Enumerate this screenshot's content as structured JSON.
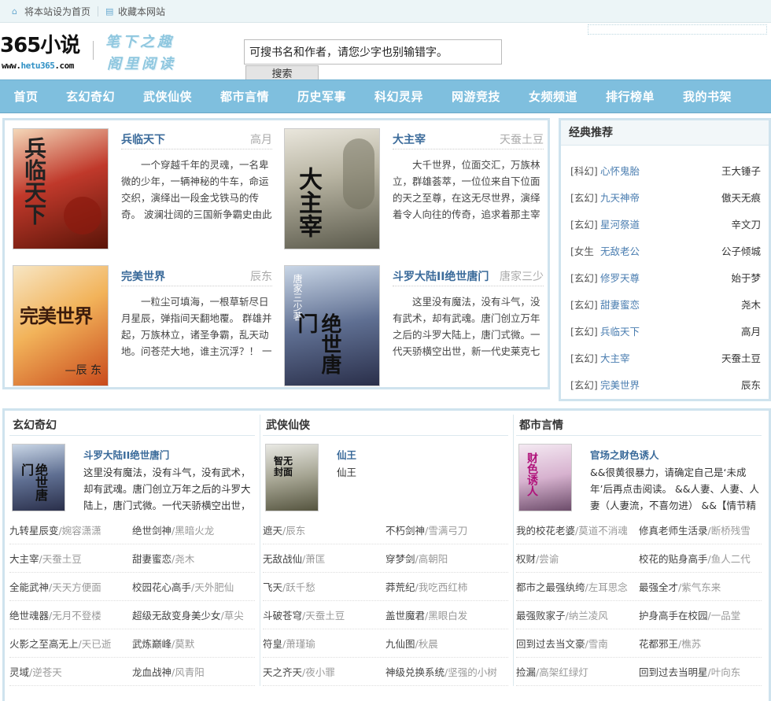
{
  "topbar": {
    "set_home": "将本站设为首页",
    "bookmark": "收藏本网站"
  },
  "header": {
    "logo_text": "365小说",
    "logo_domain_prefix": "www.",
    "logo_domain_main": "hetu365",
    "logo_domain_suffix": ".com",
    "slogan_line1": "笔下之趣",
    "slogan_line2": "阁里阅读",
    "search_placeholder": "可搜书名和作者，请您少字也别输错字。",
    "search_button": "搜索"
  },
  "nav": [
    "首页",
    "玄幻奇幻",
    "武侠仙侠",
    "都市言情",
    "历史军事",
    "科幻灵异",
    "网游竞技",
    "女频频道",
    "排行榜单",
    "我的书架"
  ],
  "featured": [
    {
      "title": "兵临天下",
      "author": "高月",
      "desc": "一个穿越千年的灵魂，一名卑微的少年，一辆神秘的牛车，命运交织，演绎出一段金戈铁马的传奇。 波澜壮阔的三国新争霸史由此拉开了序幕。 ..."
    },
    {
      "title": "大主宰",
      "author": "天蚕土豆",
      "desc": "大千世界，位面交汇，万族林立，群雄荟萃，一位位来自下位面的天之至尊，在这无尽世界，演绎着令人向往的传奇，追求着那主宰之路。 无尽火域，..."
    },
    {
      "title": "完美世界",
      "author": "辰东",
      "desc": "一粒尘可填海，一根草斩尽日月星辰，弹指间天翻地覆。 群雄并起，万族林立，诸圣争霸，乱天动地。问苍茫大地，谁主沉浮？！ 一个少年从大荒..."
    },
    {
      "title": "斗罗大陆II绝世唐门",
      "author": "唐家三少",
      "desc": "这里没有魔法，没有斗气，没有武术，却有武魂。唐门创立万年之后的斗罗大陆上，唐门式微。一代天骄横空出世，新一代史莱克七怪能否重振唐门，谱写..."
    }
  ],
  "recommend": {
    "title": "经典推荐",
    "items": [
      {
        "cat": "[科幻]",
        "title": "心怀鬼胎",
        "author": "王大锤子"
      },
      {
        "cat": "[玄幻]",
        "title": "九天神帝",
        "author": "傲天无痕"
      },
      {
        "cat": "[玄幻]",
        "title": "星河祭道",
        "author": "辛文刀"
      },
      {
        "cat": "[女生",
        "title": "无敌老公",
        "author": "公子倾城"
      },
      {
        "cat": "[玄幻]",
        "title": "修罗天尊",
        "author": "始于梦"
      },
      {
        "cat": "[玄幻]",
        "title": "甜妻蜜恋",
        "author": "尧木"
      },
      {
        "cat": "[玄幻]",
        "title": "兵临天下",
        "author": "高月"
      },
      {
        "cat": "[玄幻]",
        "title": "大主宰",
        "author": "天蚕土豆"
      },
      {
        "cat": "[玄幻]",
        "title": "完美世界",
        "author": "辰东"
      }
    ]
  },
  "categories": [
    {
      "name": "玄幻奇幻",
      "feature_title": "斗罗大陆II绝世唐门",
      "feature_desc": "这里没有魔法，没有斗气，没有武术，却有武魂。唐门创立万年之后的斗罗大陆上，唐门式微。一代天骄横空出世，新一",
      "list": [
        [
          {
            "t": "九转星辰变",
            "a": "/婉容潇潇"
          },
          {
            "t": "绝世剑神",
            "a": "/黑暗火龙"
          }
        ],
        [
          {
            "t": "大主宰",
            "a": "/天蚕土豆"
          },
          {
            "t": "甜妻蜜恋",
            "a": "/尧木"
          }
        ],
        [
          {
            "t": "全能武神",
            "a": "/天天方便面"
          },
          {
            "t": "校园花心高手",
            "a": "/天外肥仙"
          }
        ],
        [
          {
            "t": "绝世魂器",
            "a": "/无月不登楼"
          },
          {
            "t": "超级无敌变身美少女",
            "a": "/草尖"
          }
        ],
        [
          {
            "t": "火影之至高无上",
            "a": "/天已逝"
          },
          {
            "t": "武炼巅峰",
            "a": "/莫默"
          }
        ],
        [
          {
            "t": "灵域",
            "a": "/逆苍天"
          },
          {
            "t": "龙血战神",
            "a": "/风青阳"
          }
        ]
      ]
    },
    {
      "name": "武侠仙侠",
      "feature_title": "仙王",
      "feature_desc": "仙王",
      "list": [
        [
          {
            "t": "遮天",
            "a": "/辰东"
          },
          {
            "t": "不朽剑神",
            "a": "/雪满弓刀"
          }
        ],
        [
          {
            "t": "无敌战仙",
            "a": "/萧匡"
          },
          {
            "t": "穿梦剑",
            "a": "/高朝阳"
          }
        ],
        [
          {
            "t": "飞天",
            "a": "/跃千愁"
          },
          {
            "t": "莽荒纪",
            "a": "/我吃西红柿"
          }
        ],
        [
          {
            "t": "斗破苍穹",
            "a": "/天蚕土豆"
          },
          {
            "t": "盖世魔君",
            "a": "/黑眼白发"
          }
        ],
        [
          {
            "t": "符皇",
            "a": "/萧瑾瑜"
          },
          {
            "t": "九仙图",
            "a": "/秋晨"
          }
        ],
        [
          {
            "t": "天之齐天",
            "a": "/夜小罪"
          },
          {
            "t": "神级兑换系统",
            "a": "/坚强的小树"
          }
        ]
      ]
    },
    {
      "name": "都市言情",
      "feature_title": "官场之财色诱人",
      "feature_desc": "&&很黄很暴力，请确定自己是‘未成年’后再点击阅读。 &&人妻、人妻、人妻（人妻流，不喜勿进） &&【情节精彩，",
      "list": [
        [
          {
            "t": "我的校花老婆",
            "a": "/莫道不消魂"
          },
          {
            "t": "修真老师生活录",
            "a": "/断桥残雪"
          }
        ],
        [
          {
            "t": "权财",
            "a": "/尝谕"
          },
          {
            "t": "校花的贴身高手",
            "a": "/鱼人二代"
          }
        ],
        [
          {
            "t": "都市之最强纨绔",
            "a": "/左耳思念"
          },
          {
            "t": "最强全才",
            "a": "/紫气东来"
          }
        ],
        [
          {
            "t": "最强败家子",
            "a": "/纳兰凌风"
          },
          {
            "t": "护身高手在校园",
            "a": "/一品堂"
          }
        ],
        [
          {
            "t": "回到过去当文豪",
            "a": "/雪南"
          },
          {
            "t": "花都邪王",
            "a": "/樵苏"
          }
        ],
        [
          {
            "t": "捡漏",
            "a": "/高架红绿灯"
          },
          {
            "t": "回到过去当明星",
            "a": "/叶向东"
          }
        ]
      ]
    }
  ]
}
